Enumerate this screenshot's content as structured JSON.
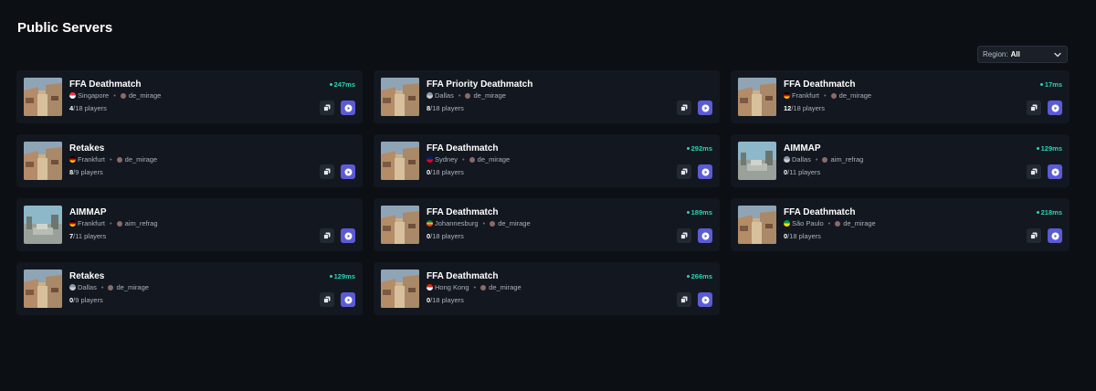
{
  "page": {
    "title": "Public Servers"
  },
  "region_filter": {
    "label": "Region:",
    "value": "All"
  },
  "colors": {
    "accent": "#5b5bd6",
    "ping": "#29d4b5",
    "background": "#0c0f14",
    "card": "#131820"
  },
  "servers": [
    {
      "name": "FFA Deathmatch",
      "flag": "sg",
      "location": "Singapore",
      "map": "de_mirage",
      "current": "4",
      "max": "/18 players",
      "ping": "247ms"
    },
    {
      "name": "FFA Priority Deathmatch",
      "flag": "us",
      "location": "Dallas",
      "map": "de_mirage",
      "current": "8",
      "max": "/18 players",
      "ping": ""
    },
    {
      "name": "FFA Deathmatch",
      "flag": "de",
      "location": "Frankfurt",
      "map": "de_mirage",
      "current": "12",
      "max": "/18 players",
      "ping": "17ms"
    },
    {
      "name": "Retakes",
      "flag": "de",
      "location": "Frankfurt",
      "map": "de_mirage",
      "current": "8",
      "max": "/9 players",
      "ping": ""
    },
    {
      "name": "FFA Deathmatch",
      "flag": "au",
      "location": "Sydney",
      "map": "de_mirage",
      "current": "0",
      "max": "/18 players",
      "ping": "292ms"
    },
    {
      "name": "AIMMAP",
      "flag": "us",
      "location": "Dallas",
      "map": "aim_refrag",
      "current": "0",
      "max": "/11 players",
      "ping": "129ms"
    },
    {
      "name": "AIMMAP",
      "flag": "de",
      "location": "Frankfurt",
      "map": "aim_refrag",
      "current": "7",
      "max": "/11 players",
      "ping": ""
    },
    {
      "name": "FFA Deathmatch",
      "flag": "za",
      "location": "Johannesburg",
      "map": "de_mirage",
      "current": "0",
      "max": "/18 players",
      "ping": "189ms"
    },
    {
      "name": "FFA Deathmatch",
      "flag": "br",
      "location": "São Paulo",
      "map": "de_mirage",
      "current": "0",
      "max": "/18 players",
      "ping": "218ms"
    },
    {
      "name": "Retakes",
      "flag": "us",
      "location": "Dallas",
      "map": "de_mirage",
      "current": "0",
      "max": "/9 players",
      "ping": "129ms"
    },
    {
      "name": "FFA Deathmatch",
      "flag": "hk",
      "location": "Hong Kong",
      "map": "de_mirage",
      "current": "0",
      "max": "/18 players",
      "ping": "266ms"
    }
  ],
  "icons": {
    "copy": "copy-icon",
    "play": "play-icon",
    "chevron": "chevron-down-icon",
    "map": "map-icon"
  }
}
